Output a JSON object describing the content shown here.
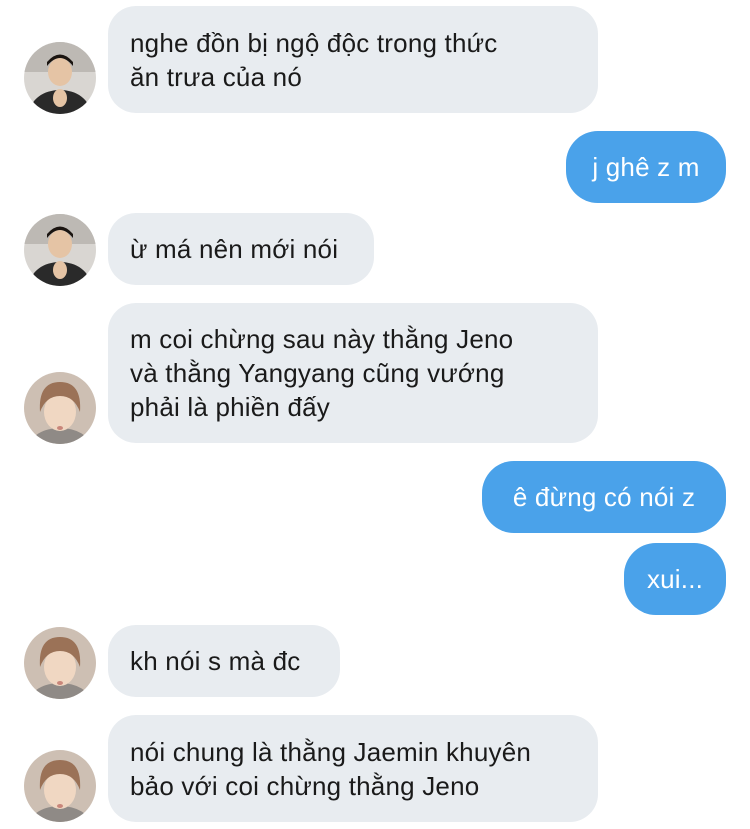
{
  "conversation": {
    "messages": [
      {
        "side": "incoming",
        "sender_avatar": "avatar-a",
        "text": "nghe đồn bị ngộ độc trong thức\năn trưa của nó"
      },
      {
        "side": "outgoing",
        "text": "j ghê z m"
      },
      {
        "side": "incoming",
        "sender_avatar": "avatar-a",
        "text": "ừ má nên mới nói"
      },
      {
        "side": "incoming",
        "sender_avatar": "avatar-b",
        "text": "m coi chừng sau này thằng Jeno\nvà thằng Yangyang cũng vướng\nphải là phiền đấy"
      },
      {
        "side": "outgoing",
        "text": "ê đừng có nói z"
      },
      {
        "side": "outgoing",
        "text": "xui..."
      },
      {
        "side": "incoming",
        "sender_avatar": "avatar-b",
        "text": "kh nói s mà đc"
      },
      {
        "side": "incoming",
        "sender_avatar": "avatar-b",
        "text": "nói chung là thằng Jaemin khuyên\nbảo với coi chừng thằng Jeno"
      }
    ]
  },
  "colors": {
    "incoming_bubble": "#e8ecf0",
    "outgoing_bubble": "#4aa2ea",
    "incoming_text": "#1a1a1a",
    "outgoing_text": "#ffffff"
  }
}
